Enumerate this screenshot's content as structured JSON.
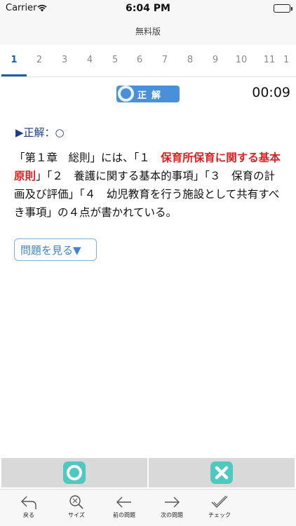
{
  "status_bar": {
    "carrier": "Carrier",
    "time": "6:04 PM"
  },
  "nav": {
    "title": "無料版"
  },
  "tabs": [
    "1",
    "2",
    "3",
    "4",
    "5",
    "6",
    "7",
    "8",
    "9",
    "10",
    "11",
    "1"
  ],
  "active_tab_index": 0,
  "result": {
    "label": "正解",
    "timer": "00:09"
  },
  "answer": {
    "prefix": "▶",
    "text": "正解：○"
  },
  "explanation": {
    "part1": "「第１章　総則」には、「１　",
    "highlight": "保育所保育に関する基本原則",
    "part2": "」「２　養護に関する基本的事項」「３　保育の計画及び評価」「４　幼児教育を行う施設として共有すべき事項」の４点が書かれている。"
  },
  "show_question": {
    "label": "問題を見る▼"
  },
  "judge": {
    "correct_icon": "circle-icon",
    "wrong_icon": "cross-icon"
  },
  "toolbar": {
    "back": "戻る",
    "size": "サイズ",
    "prev": "前の問題",
    "next": "次の問題",
    "check": "チェック"
  },
  "colors": {
    "accent": "#1e5ea8",
    "badge": "#4a90d9",
    "highlight": "#e02020",
    "judge_icon": "#4ec9c0"
  }
}
